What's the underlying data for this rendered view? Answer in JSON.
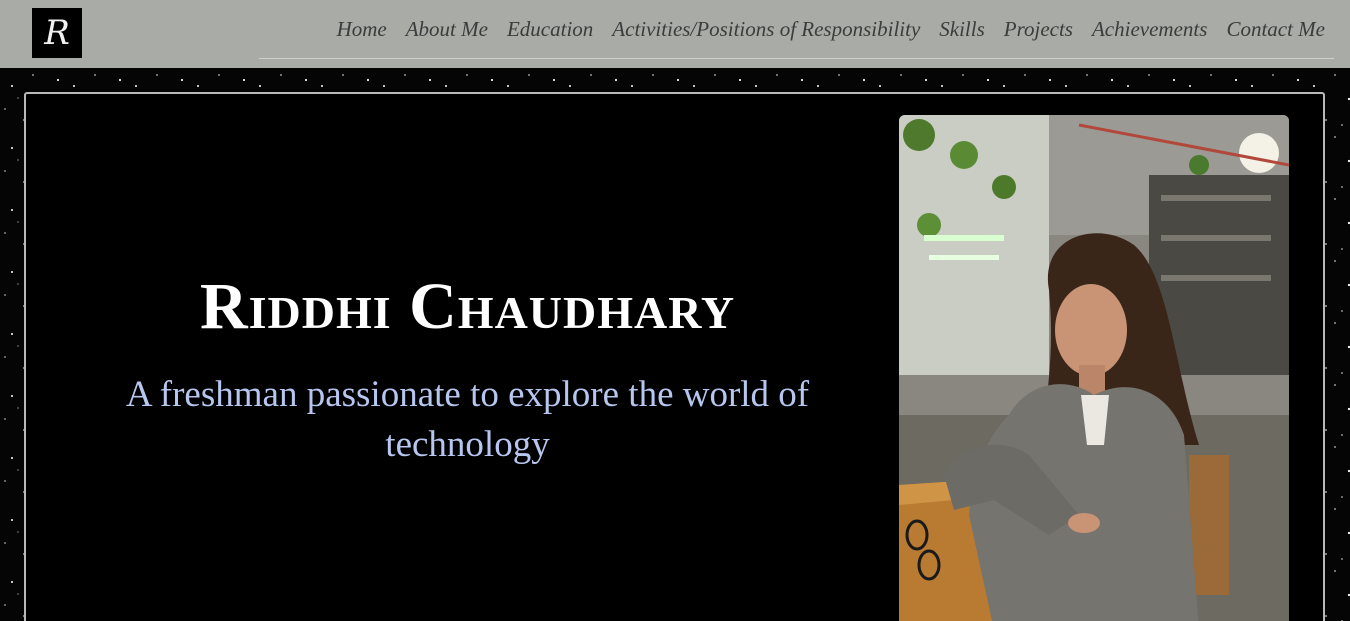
{
  "logo": {
    "letter": "R"
  },
  "nav": {
    "items": [
      {
        "label": "Home"
      },
      {
        "label": "About Me"
      },
      {
        "label": "Education"
      },
      {
        "label": "Activities/Positions of Responsibility"
      },
      {
        "label": "Skills"
      },
      {
        "label": "Projects"
      },
      {
        "label": "Achievements"
      },
      {
        "label": "Contact Me"
      }
    ]
  },
  "hero": {
    "name": "Riddhi Chaudhary",
    "tagline": "A freshman passionate to explore the world of technology"
  },
  "colors": {
    "navbar_bg": "#a8aba6",
    "nav_text": "#3c3c3c",
    "hero_bg": "#000000",
    "name_color": "#ffffff",
    "tagline_color": "#b7c6ef"
  }
}
